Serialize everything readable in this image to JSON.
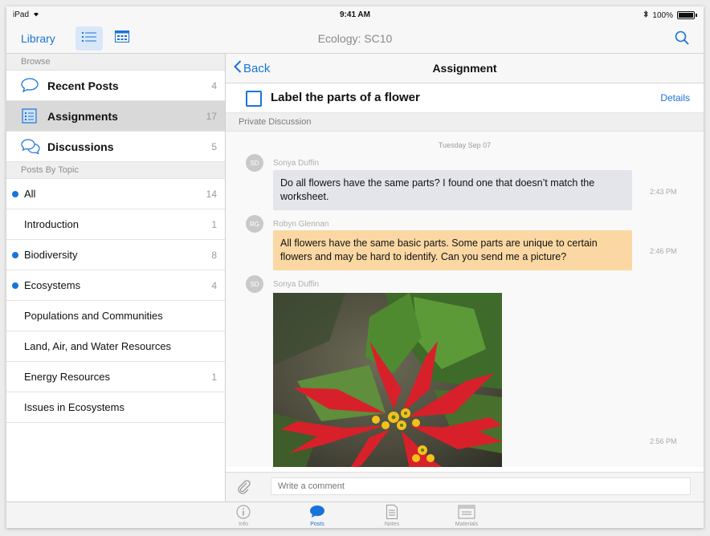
{
  "status_bar": {
    "device": "iPad",
    "time": "9:41 AM",
    "battery": "100%"
  },
  "nav": {
    "library": "Library",
    "title": "Ecology: SC10"
  },
  "sidebar": {
    "browse_header": "Browse",
    "items": [
      {
        "label": "Recent Posts",
        "count": "4",
        "icon": "speech-bubble-icon"
      },
      {
        "label": "Assignments",
        "count": "17",
        "icon": "assignment-list-icon",
        "selected": true
      },
      {
        "label": "Discussions",
        "count": "5",
        "icon": "discussion-bubbles-icon"
      }
    ],
    "topics_header": "Posts By Topic",
    "topics": [
      {
        "label": "All",
        "count": "14",
        "dot": true
      },
      {
        "label": "Introduction",
        "count": "1",
        "dot": false
      },
      {
        "label": "Biodiversity",
        "count": "8",
        "dot": true
      },
      {
        "label": "Ecosystems",
        "count": "4",
        "dot": true
      },
      {
        "label": "Populations and Communities",
        "count": "",
        "dot": false
      },
      {
        "label": "Land, Air, and Water Resources",
        "count": "",
        "dot": false
      },
      {
        "label": "Energy Resources",
        "count": "1",
        "dot": false
      },
      {
        "label": "Issues in Ecosystems",
        "count": "",
        "dot": false
      }
    ]
  },
  "main": {
    "back_label": "Back",
    "title": "Assignment",
    "assignment_title": "Label the parts of a flower",
    "details_label": "Details",
    "discussion_header": "Private Discussion",
    "date": "Tuesday Sep 07",
    "messages": [
      {
        "initials": "SD",
        "sender": "Sonya Duffin",
        "text": "Do all flowers have the same parts? I found one that doesn’t match the worksheet.",
        "time": "2:43 PM"
      },
      {
        "initials": "RG",
        "sender": "Robyn Glennan",
        "text": "All flowers have the same basic parts. Some parts are unique to certain flowers and may be hard to identify. Can you send me a picture?",
        "time": "2:46 PM"
      },
      {
        "initials": "SD",
        "sender": "Sonya Duffin",
        "time": "2:56 PM"
      }
    ],
    "comment_placeholder": "Write a comment"
  },
  "tabbar": {
    "tabs": [
      {
        "label": "Info",
        "icon": "info-icon"
      },
      {
        "label": "Posts",
        "icon": "posts-bubble-icon",
        "active": true
      },
      {
        "label": "Notes",
        "icon": "notes-icon"
      },
      {
        "label": "Materials",
        "icon": "materials-icon"
      }
    ]
  },
  "colors": {
    "accent": "#1a73d9",
    "selected_row": "#d9d9d9",
    "teacher_bubble": "#fbd8a3",
    "student_bubble": "#e3e5ea"
  }
}
